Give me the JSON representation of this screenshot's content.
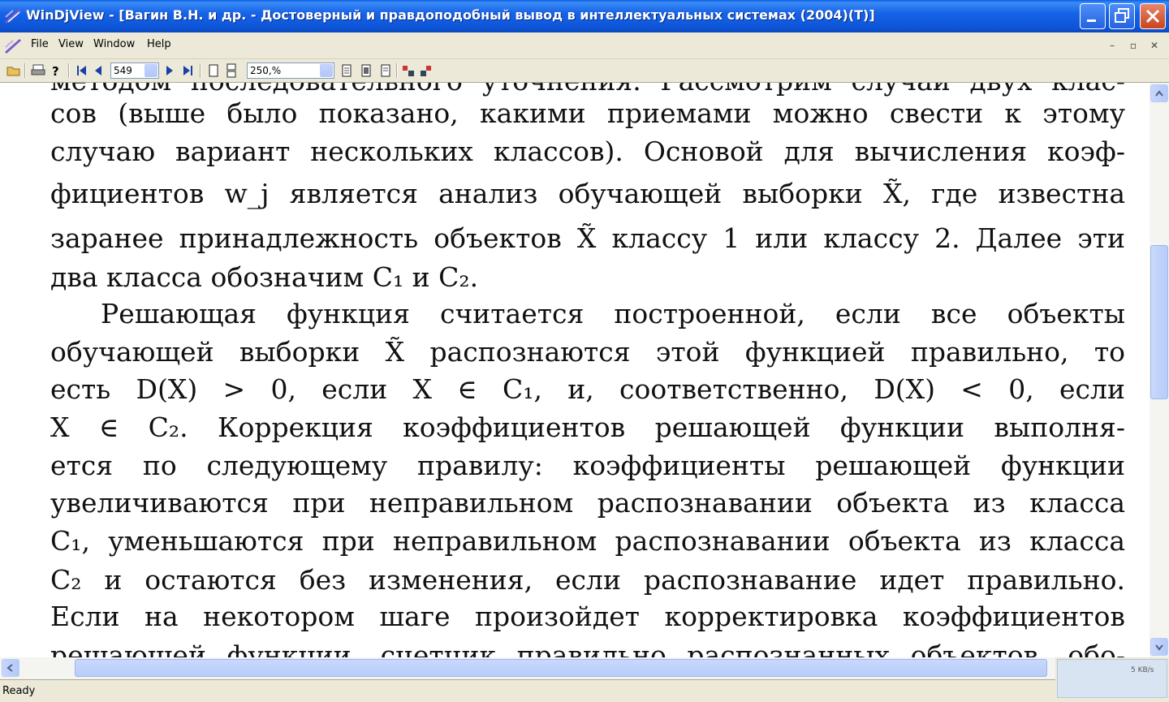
{
  "window": {
    "title": "WinDjView - [Вагин В.Н. и др. - Достоверный и правдоподобный вывод в интеллектуальных системах (2004)(T)]"
  },
  "menu": {
    "items": [
      "File",
      "View",
      "Window",
      "Help"
    ]
  },
  "toolbar": {
    "page_value": "549",
    "zoom_value": "250,%"
  },
  "document": {
    "lines": [
      "методом последовательного уточнения. Рассмотрим случай двух клас-",
      "сов (выше было показано, какими приемами можно свести к этому",
      "случаю вариант нескольких классов). Основой для вычисления коэф-",
      "фициентов w_j является анализ обучающей выборки X̃, где известна",
      "заранее принадлежность объектов X̃ классу 1 или классу 2. Далее эти",
      "два класса обозначим C₁ и C₂.",
      "Решающая функция считается построенной, если все объекты",
      "обучающей выборки X̃ распознаются этой функцией правильно, то",
      "есть D(X) > 0, если X ∈ C₁, и, соответственно, D(X) < 0, если",
      "X ∈ C₂. Коррекция коэффициентов решающей функции выполня-",
      "ется по следующему правилу: коэффициенты решающей функции",
      "увеличиваются при неправильном распознавании объекта из класса",
      "C₁, уменьшаются при неправильном распознавании объекта из класса",
      "C₂ и остаются без изменения, если распознавание идет правильно.",
      "Если на некотором шаге произойдет корректировка коэффициентов",
      "решающей функции, счетчик правильно распознанных объектов, обо-"
    ]
  },
  "status": {
    "text": "Ready",
    "speed": "5 KB/s"
  },
  "colors": {
    "title_blue": "#0A5FE6",
    "close_red": "#C9431D",
    "chrome": "#ECE9D8"
  }
}
